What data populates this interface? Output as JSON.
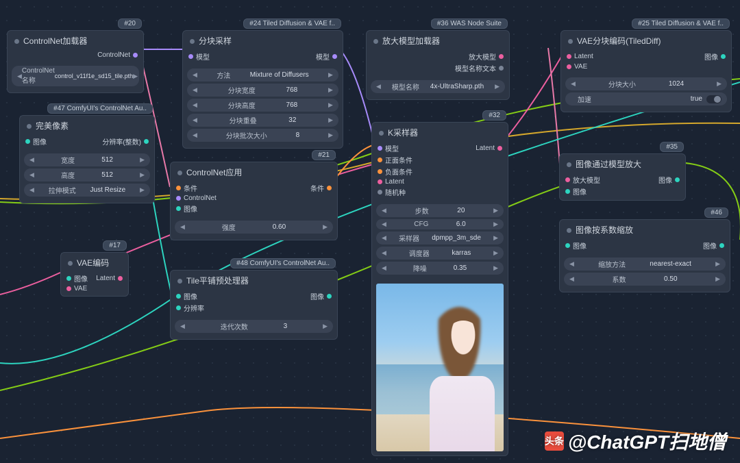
{
  "watermark": {
    "logo_text": "头条",
    "author": "@ChatGPT扫地僧"
  },
  "nodes": {
    "n20": {
      "badge": "#20",
      "title": "ControlNet加载器",
      "out1": "ControlNet",
      "w1_label": "ControlNet名称",
      "w1_val": "control_v11f1e_sd15_tile.pth"
    },
    "n47": {
      "badge": "#47 ComfyUI's ControlNet Au..",
      "title": "完美像素",
      "in1": "图像",
      "out1": "分辨率(整数)",
      "w1_l": "宽度",
      "w1_v": "512",
      "w2_l": "高度",
      "w2_v": "512",
      "w3_l": "拉伸模式",
      "w3_v": "Just Resize"
    },
    "n17": {
      "badge": "#17",
      "title": "VAE编码",
      "in1": "图像",
      "in2": "VAE",
      "out1": "Latent"
    },
    "n24": {
      "badge": "#24 Tiled Diffusion & VAE f..",
      "title": "分块采样",
      "in1": "模型",
      "out1": "模型",
      "w1_l": "方法",
      "w1_v": "Mixture of Diffusers",
      "w2_l": "分块宽度",
      "w2_v": "768",
      "w3_l": "分块高度",
      "w3_v": "768",
      "w4_l": "分块重叠",
      "w4_v": "32",
      "w5_l": "分块批次大小",
      "w5_v": "8"
    },
    "n21": {
      "badge": "#21",
      "title": "ControlNet应用",
      "in1": "条件",
      "in2": "ControlNet",
      "in3": "图像",
      "out1": "条件",
      "w1_l": "强度",
      "w1_v": "0.60"
    },
    "n48": {
      "badge": "#48 ComfyUI's ControlNet Au..",
      "title": "Tile平铺预处理器",
      "in1": "图像",
      "in2": "分辨率",
      "out1": "图像",
      "w1_l": "迭代次数",
      "w1_v": "3"
    },
    "n36": {
      "badge": "#36 WAS Node Suite",
      "title": "放大模型加载器",
      "out1": "放大模型",
      "out2": "模型名称文本",
      "w1_l": "模型名称",
      "w1_v": "4x-UltraSharp.pth"
    },
    "n32": {
      "badge": "#32",
      "title": "K采样器",
      "in1": "模型",
      "in2": "正面条件",
      "in3": "负面条件",
      "in4": "Latent",
      "in5": "随机种",
      "out1": "Latent",
      "w1_l": "步数",
      "w1_v": "20",
      "w2_l": "CFG",
      "w2_v": "6.0",
      "w3_l": "采样器",
      "w3_v": "dpmpp_3m_sde",
      "w4_l": "调度器",
      "w4_v": "karras",
      "w5_l": "降噪",
      "w5_v": "0.35"
    },
    "n25": {
      "badge": "#25 Tiled Diffusion & VAE f..",
      "title": "VAE分块编码(TiledDiff)",
      "in1": "Latent",
      "in2": "VAE",
      "out1": "图像",
      "w1_l": "分块大小",
      "w1_v": "1024",
      "w2_l": "加速",
      "w2_v": "true"
    },
    "n35": {
      "badge": "#35",
      "title": "图像通过模型放大",
      "in1": "放大模型",
      "in2": "图像",
      "out1": "图像"
    },
    "n46": {
      "badge": "#46",
      "title": "图像按系数缩放",
      "in1": "图像",
      "out1": "图像",
      "w1_l": "缩放方法",
      "w1_v": "nearest-exact",
      "w2_l": "系数",
      "w2_v": "0.50"
    }
  }
}
